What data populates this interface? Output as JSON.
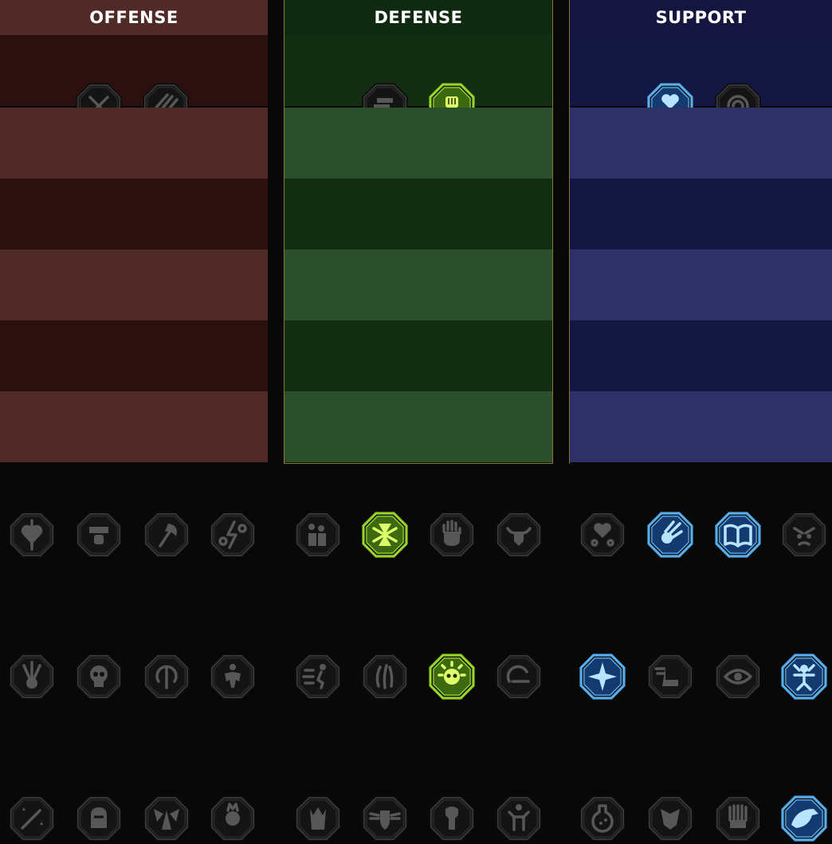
{
  "columns": [
    {
      "id": "offense",
      "title": "OFFENSE",
      "colors": {
        "header": "#4f2a26",
        "band_dark": "#2b1010",
        "band_light": "#4f2a26",
        "active_glow": "#d04030",
        "active_fill": "#3a0d0b",
        "active_icon": "#ff8a70"
      },
      "tiers": [
        [
          {
            "icon": "crossed-swords-icon",
            "active": false
          },
          {
            "icon": "claw-slash-icon",
            "active": false
          }
        ],
        [
          {
            "icon": "horned-demon-icon",
            "active": false
          },
          {
            "icon": "slash-strike-icon",
            "active": false
          },
          {
            "icon": "shield-pierce-icon",
            "active": false
          },
          {
            "icon": "broken-heart-icon",
            "active": false
          }
        ],
        [
          {
            "icon": "arrow-pierced-body-icon",
            "active": false
          },
          {
            "icon": "fanged-maw-icon",
            "active": false
          },
          {
            "icon": "skull-dash-icon",
            "active": false
          },
          {
            "icon": "fist-blade-icon",
            "active": false
          }
        ],
        [
          {
            "icon": "pierced-heart-icon",
            "active": false
          },
          {
            "icon": "hammer-fist-icon",
            "active": false
          },
          {
            "icon": "battle-axe-icon",
            "active": false
          },
          {
            "icon": "chained-lightning-icon",
            "active": false
          }
        ],
        [
          {
            "icon": "arrows-target-icon",
            "active": false
          },
          {
            "icon": "skull-icon",
            "active": false
          },
          {
            "icon": "dagger-circle-icon",
            "active": false
          },
          {
            "icon": "brute-icon",
            "active": false
          }
        ],
        [
          {
            "icon": "sword-sparkle-icon",
            "active": false
          },
          {
            "icon": "knight-helm-icon",
            "active": false
          },
          {
            "icon": "winged-demon-icon",
            "active": false
          },
          {
            "icon": "flaming-skull-icon",
            "active": false
          }
        ]
      ]
    },
    {
      "id": "defense",
      "title": "DEFENSE",
      "colors": {
        "header": "#0f2a10",
        "band_dark": "#132e13",
        "band_light": "#2c4f2c",
        "active_glow": "#9ee02a",
        "active_fill": "#3d6a10",
        "active_icon": "#dfff6a"
      },
      "tiers": [
        [
          {
            "icon": "brick-wall-icon",
            "active": false
          },
          {
            "icon": "raised-fist-icon",
            "active": true
          }
        ],
        [
          {
            "icon": "layered-shield-icon",
            "active": false
          },
          {
            "icon": "anatomical-heart-icon",
            "active": true
          },
          {
            "icon": "armored-torso-icon",
            "active": false
          },
          {
            "icon": "deflect-blades-icon",
            "active": true
          }
        ],
        [
          {
            "icon": "dodge-figure-icon",
            "active": false
          },
          {
            "icon": "knight-shield-icon",
            "active": true
          },
          {
            "icon": "heart-shield-icon",
            "active": false
          },
          {
            "icon": "halo-head-icon",
            "active": true
          }
        ],
        [
          {
            "icon": "crowd-icon",
            "active": false
          },
          {
            "icon": "hourglass-icon",
            "active": true
          },
          {
            "icon": "open-hand-icon",
            "active": false
          },
          {
            "icon": "bull-head-icon",
            "active": false
          }
        ],
        [
          {
            "icon": "dash-runner-icon",
            "active": false
          },
          {
            "icon": "claw-marks-icon",
            "active": false
          },
          {
            "icon": "sun-skull-icon",
            "active": true
          },
          {
            "icon": "swirl-icon",
            "active": false
          }
        ],
        [
          {
            "icon": "spiked-warrior-icon",
            "active": false
          },
          {
            "icon": "winged-shield-icon",
            "active": false
          },
          {
            "icon": "hooded-figure-icon",
            "active": false
          },
          {
            "icon": "flexing-figure-icon",
            "active": false
          }
        ]
      ]
    },
    {
      "id": "support",
      "title": "SUPPORT",
      "colors": {
        "header": "#141640",
        "band_dark": "#141742",
        "band_light": "#2e3068",
        "active_glow": "#5ab8ff",
        "active_fill": "#143a70",
        "active_icon": "#b8e4ff"
      },
      "tiers": [
        [
          {
            "icon": "heart-plus-icon",
            "active": true
          },
          {
            "icon": "cyclone-icon",
            "active": false
          }
        ],
        [
          {
            "icon": "praying-hands-icon",
            "active": true
          },
          {
            "icon": "shield-rings-icon",
            "active": false
          },
          {
            "icon": "poison-skull-icon",
            "active": false
          },
          {
            "icon": "swift-arrow-icon",
            "active": false
          }
        ],
        [
          {
            "icon": "blessed-figure-icon",
            "active": true
          },
          {
            "icon": "lightning-shield-icon",
            "active": false
          },
          {
            "icon": "ground-crack-icon",
            "active": false
          },
          {
            "icon": "shadow-figures-icon",
            "active": false
          }
        ],
        [
          {
            "icon": "chained-heart-icon",
            "active": false
          },
          {
            "icon": "meteor-icon",
            "active": true
          },
          {
            "icon": "open-book-icon",
            "active": true
          },
          {
            "icon": "angry-face-icon",
            "active": false
          }
        ],
        [
          {
            "icon": "compass-star-icon",
            "active": true
          },
          {
            "icon": "winged-boot-icon",
            "active": false
          },
          {
            "icon": "eye-icon",
            "active": false
          },
          {
            "icon": "voodoo-doll-icon",
            "active": true
          }
        ],
        [
          {
            "icon": "potion-bottle-icon",
            "active": false
          },
          {
            "icon": "skull-mask-icon",
            "active": false
          },
          {
            "icon": "claw-hand-icon",
            "active": false
          },
          {
            "icon": "eagle-head-icon",
            "active": true
          }
        ]
      ]
    }
  ]
}
